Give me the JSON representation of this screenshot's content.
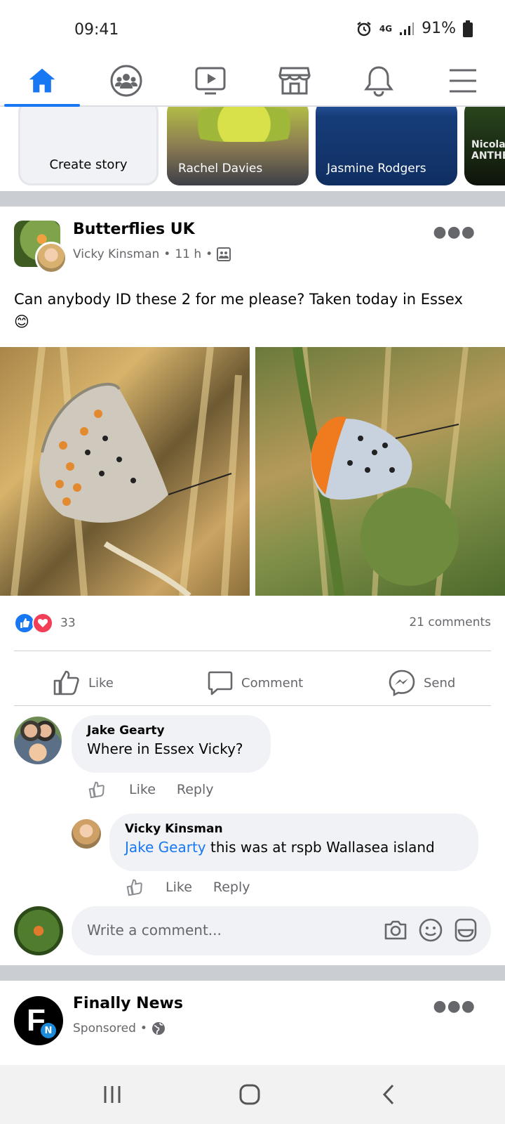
{
  "status_bar": {
    "time": "09:41",
    "network": "4G",
    "battery": "91%"
  },
  "nav": {
    "items": [
      "home-icon",
      "groups-icon",
      "watch-icon",
      "marketplace-icon",
      "notifications-icon",
      "menu-icon"
    ],
    "active": "home-icon",
    "accent": "#1877f2"
  },
  "stories": {
    "create_label": "Create story",
    "items": [
      {
        "name": "Rachel Davies"
      },
      {
        "name": "Jasmine Rodgers"
      },
      {
        "name": "Nicola\nANTHE"
      }
    ]
  },
  "post": {
    "group": "Butterflies UK",
    "author": "Vicky Kinsman",
    "time": "11 h",
    "text": "Can anybody ID these 2 for me please? Taken today in Essex",
    "emoji": "😊",
    "reaction_count": "33",
    "comments_count": "21 comments",
    "actions": {
      "like": "Like",
      "comment": "Comment",
      "send": "Send"
    }
  },
  "comments": [
    {
      "name": "Jake Gearty",
      "text": "Where in Essex Vicky?",
      "like": "Like",
      "reply": "Reply"
    },
    {
      "name": "Vicky Kinsman",
      "mention": "Jake Gearty",
      "text": " this was at rspb Wallasea island",
      "like": "Like",
      "reply": "Reply"
    }
  ],
  "write_comment": {
    "placeholder": "Write a comment..."
  },
  "next_post": {
    "title": "Finally News",
    "meta": "Sponsored",
    "logo_letter": "F",
    "logo_badge": "N"
  }
}
